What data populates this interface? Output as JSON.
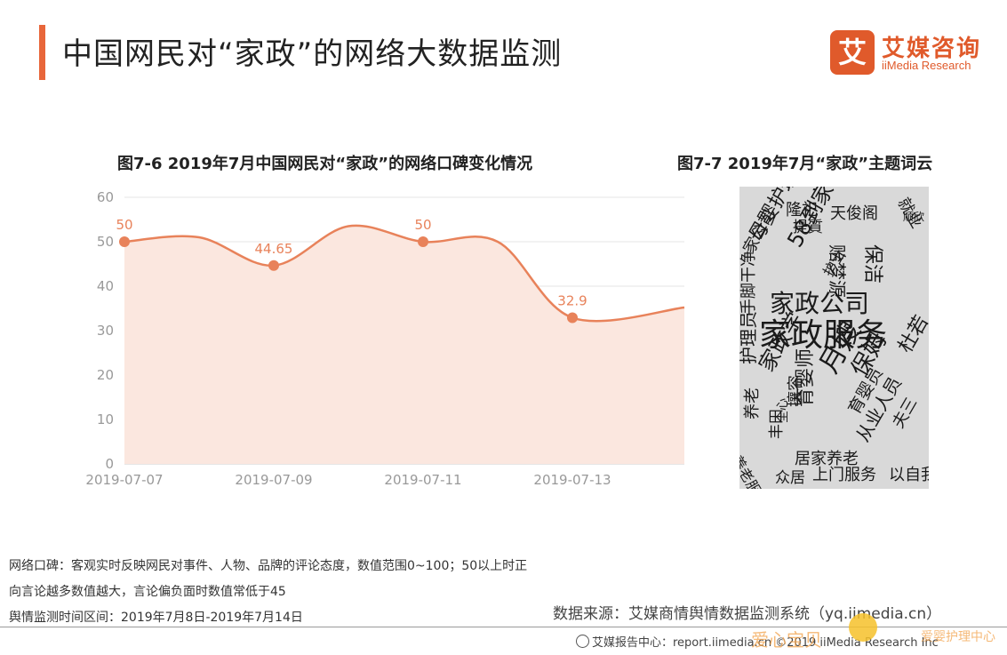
{
  "page": {
    "title": "中国网民对“家政”的网络大数据监测"
  },
  "logo": {
    "mark": "艾",
    "cn": "艾媒咨询",
    "en": "iiMedia Research"
  },
  "chart_title": "图7-6 2019年7月中国网民对“家政”的网络口碑变化情况",
  "cloud_title": "图7-7 2019年7月“家政”主题词云",
  "chart_data": {
    "type": "area",
    "title": "图7-6 2019年7月中国网民对“家政”的网络口碑变化情况",
    "xlabel": "",
    "ylabel": "",
    "ylim": [
      0,
      60
    ],
    "yticks": [
      0,
      10,
      20,
      30,
      40,
      50,
      60
    ],
    "xticks": [
      "2019-07-07",
      "2019-07-09",
      "2019-07-11",
      "2019-07-13"
    ],
    "grid": true,
    "color": "#e8825a",
    "fill": "#fbe7df",
    "series": [
      {
        "x": [
          "2019-07-07",
          "2019-07-08",
          "2019-07-09",
          "2019-07-10",
          "2019-07-11",
          "2019-07-12",
          "2019-07-13",
          "2019-07-14"
        ],
        "values": [
          50,
          51,
          44.65,
          53.5,
          50,
          50,
          32.9,
          35.2
        ],
        "labels": [
          "50",
          "",
          "44.65",
          "",
          "50",
          "",
          "32.9",
          ""
        ]
      }
    ]
  },
  "wordcloud": {
    "words": [
      "家政服务",
      "家政公司",
      "58到家",
      "月嫂",
      "保姆",
      "家政学",
      "护理员",
      "中国家政",
      "隆祀",
      "天俊阁",
      "提質",
      "贻梦源",
      "保洁",
      "育婴师",
      "育婴员",
      "攘容",
      "从业人员",
      "上门服务",
      "众居",
      "居家养老",
      "丰田",
      "全心",
      "养老",
      "手脚干净",
      "母婴护理",
      "家公司",
      "以自我",
      "顺欣",
      "就业",
      "护士",
      "杜若",
      "养老服务",
      "夫三"
    ]
  },
  "notes": {
    "line1": "网络口碑：客观实时反映网民对事件、人物、品牌的评论态度，数值范围0~100；50以上时正",
    "line2": "向言论越多数值越大，言论偏负面时数值常低于45",
    "line3": "舆情监测时间区间：2019年7月8日-2019年7月14日"
  },
  "source": "数据来源：艾媒商情舆情数据监测系统（yq.iimedia.cn）",
  "footer": "艾媒报告中心：report.iimedia.cn ©2019 iiMedia Research Inc",
  "watermark": {
    "left": "爱心宝贝",
    "right": "爱婴护理中心"
  }
}
